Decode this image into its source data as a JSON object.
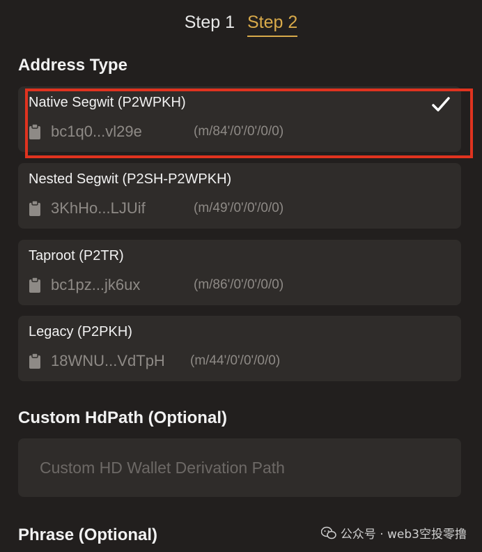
{
  "steps": [
    {
      "label": "Step 1",
      "active": false
    },
    {
      "label": "Step 2",
      "active": true
    }
  ],
  "address_type": {
    "title": "Address Type",
    "options": [
      {
        "name": "Native Segwit (P2WPKH)",
        "address": "bc1q0...vl29e",
        "path": "(m/84'/0'/0'/0/0)",
        "selected": true
      },
      {
        "name": "Nested Segwit (P2SH-P2WPKH)",
        "address": "3KhHo...LJUif",
        "path": "(m/49'/0'/0'/0/0)",
        "selected": false
      },
      {
        "name": "Taproot (P2TR)",
        "address": "bc1pz...jk6ux",
        "path": "(m/86'/0'/0'/0/0)",
        "selected": false
      },
      {
        "name": "Legacy (P2PKH)",
        "address": "18WNU...VdTpH",
        "path": "(m/44'/0'/0'/0/0)",
        "selected": false
      }
    ]
  },
  "custom_hdpath": {
    "title": "Custom HdPath (Optional)",
    "value": "",
    "placeholder": "Custom HD Wallet Derivation Path"
  },
  "phrase": {
    "title": "Phrase (Optional)"
  },
  "watermark": {
    "text": "公众号 · web3空投零撸",
    "icon": "wechat-icon"
  },
  "icons": {
    "copy": "clipboard-icon",
    "selected": "checkmark-icon"
  },
  "colors": {
    "background": "#221f1e",
    "card": "#2f2c2a",
    "accent": "#d9aa4a",
    "highlight": "#e0331f",
    "muted_text": "#8e8a86"
  }
}
